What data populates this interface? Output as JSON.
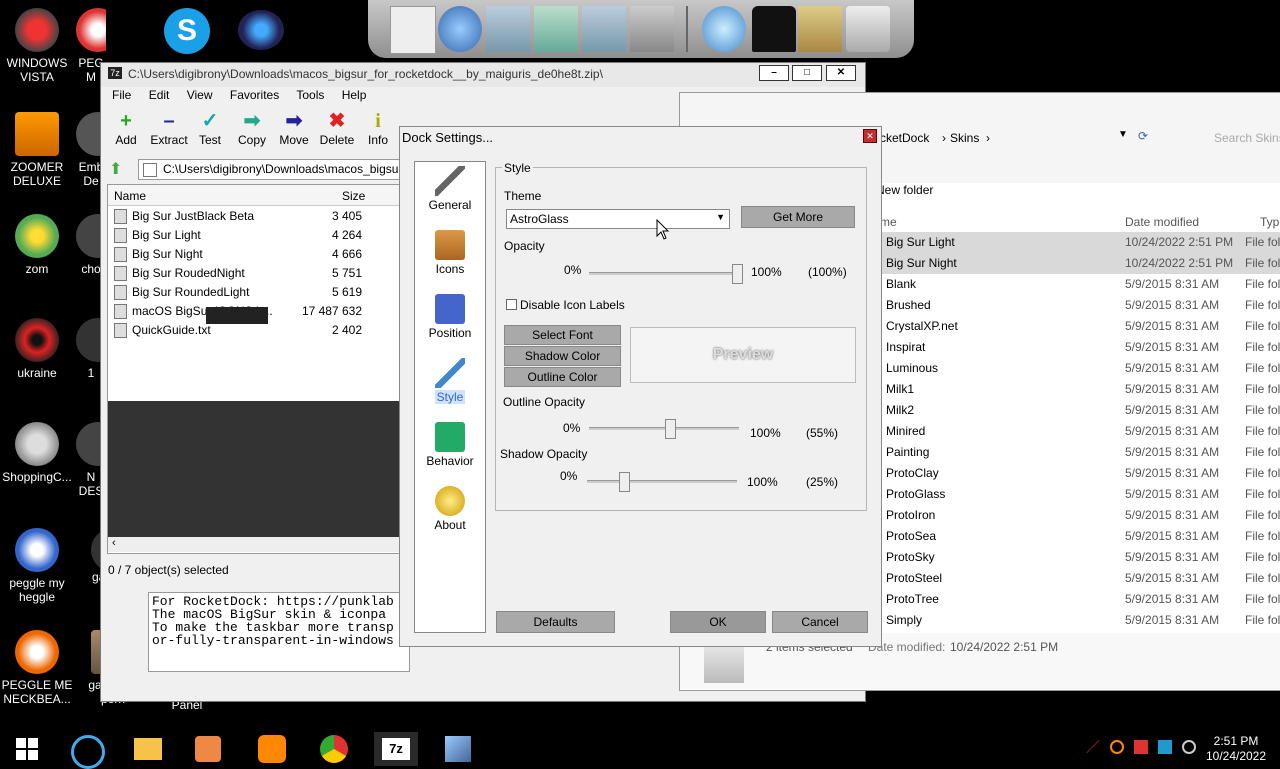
{
  "desktop": {
    "icons": [
      {
        "label": "WINDOWS VISTA"
      },
      {
        "label": "PEG M"
      },
      {
        "label": "ZOOMER DELUXE"
      },
      {
        "label": "Emb De"
      },
      {
        "label": "zom"
      },
      {
        "label": "cho"
      },
      {
        "label": "ukraine"
      },
      {
        "label": "1"
      },
      {
        "label": "ShoppingC..."
      },
      {
        "label": "N DES"
      },
      {
        "label": "peggle my heggle"
      },
      {
        "label": "gaymes"
      },
      {
        "label": "PEGGLE ME NECKBEA..."
      },
      {
        "label": "gay fiurry porn"
      },
      {
        "label": "Panel"
      }
    ]
  },
  "zip_window": {
    "title": "C:\\Users\\digibrony\\Downloads\\macos_bigsur_for_rocketdock__by_maiguris_de0he8t.zip\\",
    "menu": [
      "File",
      "Edit",
      "View",
      "Favorites",
      "Tools",
      "Help"
    ],
    "toolbar": [
      {
        "label": "Add",
        "glyph": "+"
      },
      {
        "label": "Extract",
        "glyph": "–"
      },
      {
        "label": "Test",
        "glyph": "✓"
      },
      {
        "label": "Copy",
        "glyph": "➡"
      },
      {
        "label": "Move",
        "glyph": "➡"
      },
      {
        "label": "Delete",
        "glyph": "✖"
      },
      {
        "label": "Info",
        "glyph": "i"
      }
    ],
    "address": "C:\\Users\\digibrony\\Downloads\\macos_bigsu",
    "columns": {
      "name": "Name",
      "size": "Size"
    },
    "files": [
      {
        "name": "Big Sur JustBlack Beta",
        "size": "3 405"
      },
      {
        "name": "Big Sur Light",
        "size": "4 264"
      },
      {
        "name": "Big Sur Night",
        "size": "4 666"
      },
      {
        "name": "Big Sur RoudedNight",
        "size": "5 751"
      },
      {
        "name": "Big Sur RoundedLight",
        "size": "5 619"
      },
      {
        "name": "macOS BigSur ICONS b...",
        "size": "17 487 632"
      },
      {
        "name": "QuickGuide.txt",
        "size": "2 402"
      }
    ],
    "status": "0 / 7 object(s) selected"
  },
  "notepad": {
    "lines": [
      "For RocketDock: https://punklab",
      "The macOS BigSur skin &  iconpa",
      "To make the taskbar more transp",
      "or-fully-transparent-in-windows"
    ]
  },
  "explorer": {
    "breadcrumb": [
      "cketDock",
      "Skins"
    ],
    "search_placeholder": "Search Skins",
    "new_folder": "New folder",
    "columns": {
      "name": "me",
      "date": "Date modified",
      "type": "Type"
    },
    "rows": [
      {
        "name": "Big Sur Light",
        "date": "10/24/2022 2:51 PM",
        "type": "File fol",
        "selected": true
      },
      {
        "name": "Big Sur Night",
        "date": "10/24/2022 2:51 PM",
        "type": "File fol",
        "selected": true
      },
      {
        "name": "Blank",
        "date": "5/9/2015 8:31 AM",
        "type": "File fol"
      },
      {
        "name": "Brushed",
        "date": "5/9/2015 8:31 AM",
        "type": "File fol"
      },
      {
        "name": "CrystalXP.net",
        "date": "5/9/2015 8:31 AM",
        "type": "File fol"
      },
      {
        "name": "Inspirat",
        "date": "5/9/2015 8:31 AM",
        "type": "File fol"
      },
      {
        "name": "Luminous",
        "date": "5/9/2015 8:31 AM",
        "type": "File fol"
      },
      {
        "name": "Milk1",
        "date": "5/9/2015 8:31 AM",
        "type": "File fol"
      },
      {
        "name": "Milk2",
        "date": "5/9/2015 8:31 AM",
        "type": "File fol"
      },
      {
        "name": "Minired",
        "date": "5/9/2015 8:31 AM",
        "type": "File fol"
      },
      {
        "name": "Painting",
        "date": "5/9/2015 8:31 AM",
        "type": "File fol"
      },
      {
        "name": "ProtoClay",
        "date": "5/9/2015 8:31 AM",
        "type": "File fol"
      },
      {
        "name": "ProtoGlass",
        "date": "5/9/2015 8:31 AM",
        "type": "File fol"
      },
      {
        "name": "ProtoIron",
        "date": "5/9/2015 8:31 AM",
        "type": "File fol"
      },
      {
        "name": "ProtoSea",
        "date": "5/9/2015 8:31 AM",
        "type": "File fol"
      },
      {
        "name": "ProtoSky",
        "date": "5/9/2015 8:31 AM",
        "type": "File fol"
      },
      {
        "name": "ProtoSteel",
        "date": "5/9/2015 8:31 AM",
        "type": "File fol"
      },
      {
        "name": "ProtoTree",
        "date": "5/9/2015 8:31 AM",
        "type": "File fol"
      },
      {
        "name": "Simply",
        "date": "5/9/2015 8:31 AM",
        "type": "File fol"
      }
    ],
    "status_selected": "2 items selected",
    "status_date_label": "Date modified:",
    "status_date": "10/24/2022 2:51 PM"
  },
  "dock_settings": {
    "title": "Dock Settings...",
    "categories": [
      {
        "label": "General"
      },
      {
        "label": "Icons"
      },
      {
        "label": "Position"
      },
      {
        "label": "Style",
        "active": true
      },
      {
        "label": "Behavior"
      },
      {
        "label": "About"
      }
    ],
    "group_label": "Style",
    "theme_label": "Theme",
    "theme_value": "AstroGlass",
    "get_more": "Get More",
    "opacity_label": "Opacity",
    "opacity_min": "0%",
    "opacity_max": "100%",
    "opacity_value": "(100%)",
    "opacity_level": 1.0,
    "disable_labels": "Disable Icon Labels",
    "select_font": "Select Font",
    "shadow_color": "Shadow Color",
    "outline_color": "Outline Color",
    "preview": "Preview",
    "outline_opacity_label": "Outline Opacity",
    "outline_min": "0%",
    "outline_max": "100%",
    "outline_value": "(55%)",
    "outline_level": 0.55,
    "shadow_opacity_label": "Shadow Opacity",
    "shadow_min": "0%",
    "shadow_max": "100%",
    "shadow_value": "(25%)",
    "shadow_level": 0.25,
    "defaults": "Defaults",
    "ok": "OK",
    "cancel": "Cancel"
  },
  "taskbar": {
    "clock_time": "2:51 PM",
    "clock_date": "10/24/2022"
  }
}
